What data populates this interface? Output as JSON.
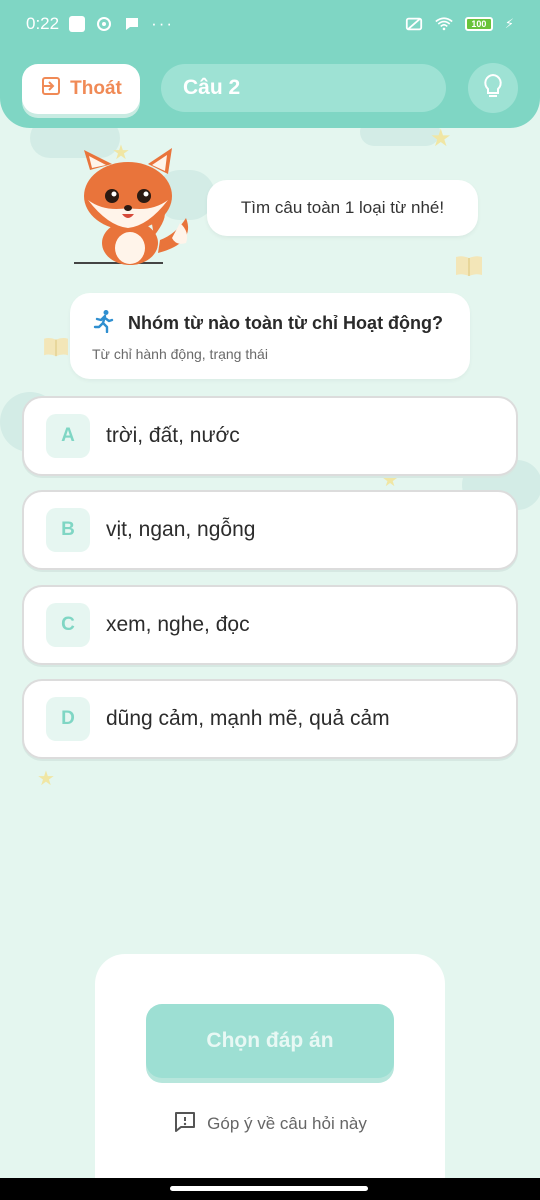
{
  "status_bar": {
    "time": "0:22",
    "battery": "100"
  },
  "header": {
    "exit_label": "Thoát",
    "question_number": "Câu 2"
  },
  "mascot": {
    "speech": "Tìm câu toàn 1 loại từ nhé!"
  },
  "question": {
    "title": "Nhóm từ nào toàn từ chỉ Hoạt động?",
    "subtitle": "Từ chỉ hành động, trạng thái"
  },
  "options": [
    {
      "letter": "A",
      "text": "trời, đất, nước"
    },
    {
      "letter": "B",
      "text": "vịt, ngan, ngỗng"
    },
    {
      "letter": "C",
      "text": "xem, nghe, đọc"
    },
    {
      "letter": "D",
      "text": "dũng cảm, mạnh mẽ, quả cảm"
    }
  ],
  "bottom": {
    "choose_label": "Chọn đáp án",
    "feedback_label": "Góp ý về câu hỏi này"
  },
  "colors": {
    "accent": "#7fd6c4",
    "exit": "#f08a56",
    "background": "#e4f6ef"
  }
}
